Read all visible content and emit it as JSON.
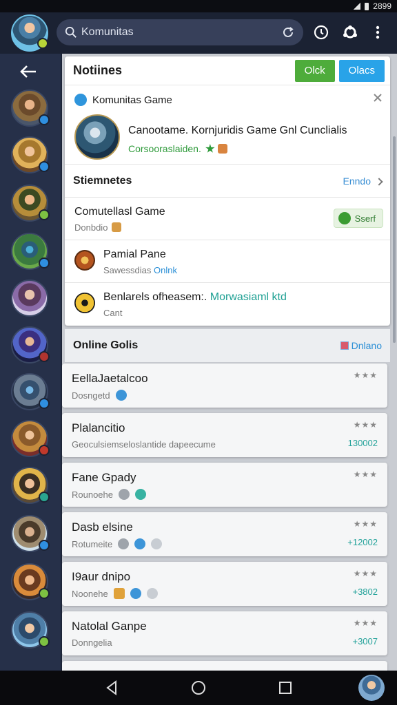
{
  "statusbar": {
    "time": "2899"
  },
  "search": {
    "value": "Komunitas"
  },
  "notifications": {
    "title": "Notiines",
    "btn_green": "Olck",
    "btn_blue": "Olacs",
    "game": {
      "name": "Komunitas Game",
      "description": "Canootame. Kornjuridis Game Gnl Cunclialis",
      "sub": "Corsooraslaiden."
    },
    "section": {
      "label": "Stiemnetes",
      "link": "Enndo"
    },
    "rows": [
      {
        "title": "Comutellasl Game",
        "sub": "Donbdio",
        "button": "Sserf"
      },
      {
        "title": "Pamial Pane",
        "sub": "Sawessdias",
        "sub_highlight": "Onlnk"
      },
      {
        "title": "Benlarels ofheasem:.",
        "title_highlight": "Morwasiaml ktd",
        "sub": "Cant"
      }
    ]
  },
  "online": {
    "label": "Online Golis",
    "link": "Dnlano",
    "items": [
      {
        "title": "EellaJaetalcoo",
        "sub": "Dosngetd",
        "rating": "★★★",
        "count": ""
      },
      {
        "title": "Plalancitio",
        "sub": "Geoculsiemseloslantide dapeecume",
        "rating": "★★★",
        "count": "130002"
      },
      {
        "title": "Fane Gpady",
        "sub": "Rounoehe",
        "rating": "★★★",
        "count": ""
      },
      {
        "title": "Dasb elsine",
        "sub": "Rotumeite",
        "rating": "★★★",
        "count": "+12002"
      },
      {
        "title": "I9aur dnipo",
        "sub": "Noonehe",
        "rating": "★★★",
        "count": "+3802"
      },
      {
        "title": "Natolal Ganpe",
        "sub": "Donngelia",
        "rating": "★★★",
        "count": "+3007"
      }
    ]
  },
  "colors": {
    "accent_blue": "#29a3e8",
    "accent_green": "#4eac3b",
    "rail": "#263049",
    "count_teal": "#25a39b"
  }
}
